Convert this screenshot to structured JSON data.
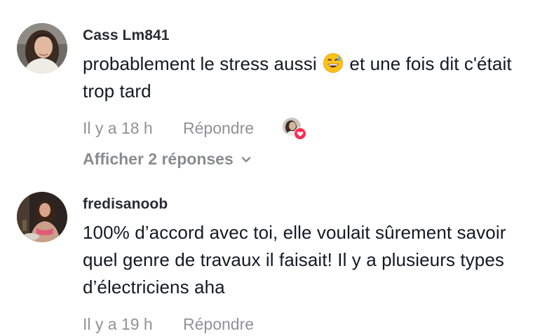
{
  "comments": [
    {
      "username": "Cass Lm841",
      "text_before_emoji": "probablement le stress aussi ",
      "emoji": "grinning-face-with-sweat",
      "text_after_emoji": " et une fois dit c'était trop tard",
      "time": "Il y a 18 h",
      "reply_label": "Répondre",
      "liked_by_creator": true,
      "view_replies_label": "Afficher 2 réponses"
    },
    {
      "username": "fredisanoob",
      "text": "100% d’accord avec toi, elle voulait sûrement savoir quel genre de travaux il faisait! Il y a plusieurs types d’électriciens aha",
      "time": "Il y a 19 h",
      "reply_label": "Répondre"
    }
  ],
  "colors": {
    "text_primary": "#161823",
    "text_secondary": "#8a8b91",
    "like_heart": "#fe2c55"
  }
}
